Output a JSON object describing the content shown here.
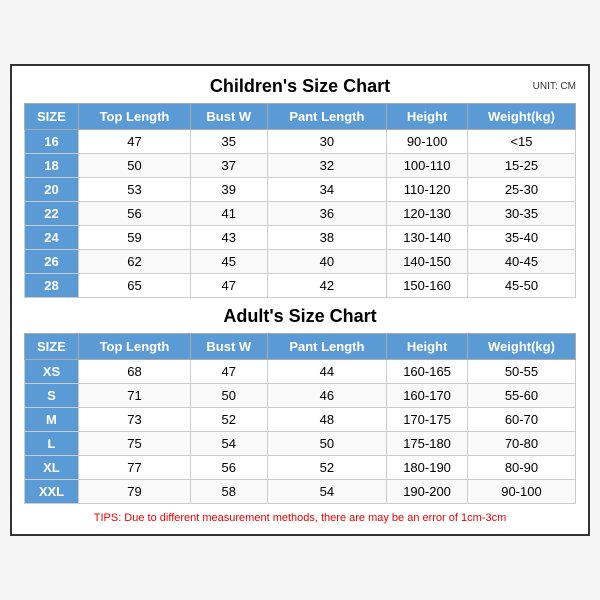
{
  "children": {
    "title": "Children's Size Chart",
    "unit": "UNIT: CM",
    "headers": [
      "SIZE",
      "Top Length",
      "Bust W",
      "Pant Length",
      "Height",
      "Weight(kg)"
    ],
    "rows": [
      [
        "16",
        "47",
        "35",
        "30",
        "90-100",
        "<15"
      ],
      [
        "18",
        "50",
        "37",
        "32",
        "100-110",
        "15-25"
      ],
      [
        "20",
        "53",
        "39",
        "34",
        "110-120",
        "25-30"
      ],
      [
        "22",
        "56",
        "41",
        "36",
        "120-130",
        "30-35"
      ],
      [
        "24",
        "59",
        "43",
        "38",
        "130-140",
        "35-40"
      ],
      [
        "26",
        "62",
        "45",
        "40",
        "140-150",
        "40-45"
      ],
      [
        "28",
        "65",
        "47",
        "42",
        "150-160",
        "45-50"
      ]
    ]
  },
  "adults": {
    "title": "Adult's Size Chart",
    "headers": [
      "SIZE",
      "Top Length",
      "Bust W",
      "Pant Length",
      "Height",
      "Weight(kg)"
    ],
    "rows": [
      [
        "XS",
        "68",
        "47",
        "44",
        "160-165",
        "50-55"
      ],
      [
        "S",
        "71",
        "50",
        "46",
        "160-170",
        "55-60"
      ],
      [
        "M",
        "73",
        "52",
        "48",
        "170-175",
        "60-70"
      ],
      [
        "L",
        "75",
        "54",
        "50",
        "175-180",
        "70-80"
      ],
      [
        "XL",
        "77",
        "56",
        "52",
        "180-190",
        "80-90"
      ],
      [
        "XXL",
        "79",
        "58",
        "54",
        "190-200",
        "90-100"
      ]
    ]
  },
  "tips": "TIPS: Due to different measurement methods, there are may be an error of 1cm-3cm"
}
